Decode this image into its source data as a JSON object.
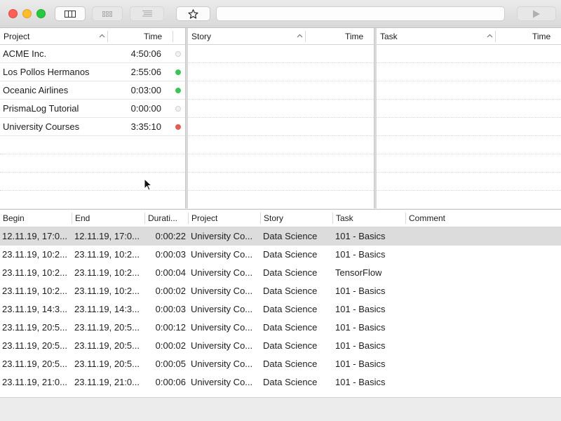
{
  "toolbar": {
    "buttons": [
      {
        "icon": "columns-view-icon",
        "enabled": true
      },
      {
        "icon": "grid-view-icon",
        "enabled": false
      },
      {
        "icon": "list-view-icon",
        "enabled": false
      },
      {
        "icon": "star-icon",
        "enabled": true
      },
      {
        "icon": "play-icon",
        "enabled": false
      }
    ],
    "search": {
      "value": "",
      "placeholder": ""
    }
  },
  "project_pane": {
    "header": {
      "col1": "Project",
      "col2": "Time"
    },
    "rows": [
      {
        "name": "ACME Inc.",
        "time": "4:50:06",
        "status": "gray"
      },
      {
        "name": "Los Pollos Hermanos",
        "time": "2:55:06",
        "status": "green"
      },
      {
        "name": "Oceanic Airlines",
        "time": "0:03:00",
        "status": "green"
      },
      {
        "name": "PrismaLog Tutorial",
        "time": "0:00:00",
        "status": "gray"
      },
      {
        "name": "University Courses",
        "time": "3:35:10",
        "status": "red"
      }
    ]
  },
  "story_pane": {
    "header": {
      "col1": "Story",
      "col2": "Time"
    }
  },
  "task_pane": {
    "header": {
      "col1": "Task",
      "col2": "Time"
    }
  },
  "log_table": {
    "columns": [
      "Begin",
      "End",
      "Durati...",
      "Project",
      "Story",
      "Task",
      "Comment"
    ],
    "rows": [
      {
        "begin": "12.11.19, 17:0...",
        "end": "12.11.19, 17:0...",
        "duration": "0:00:22",
        "project": "University Co...",
        "story": "Data Science",
        "task": "101 - Basics",
        "comment": ""
      },
      {
        "begin": "23.11.19, 10:2...",
        "end": "23.11.19, 10:2...",
        "duration": "0:00:03",
        "project": "University Co...",
        "story": "Data Science",
        "task": "101 - Basics",
        "comment": ""
      },
      {
        "begin": "23.11.19, 10:2...",
        "end": "23.11.19, 10:2...",
        "duration": "0:00:04",
        "project": "University Co...",
        "story": "Data Science",
        "task": "TensorFlow",
        "comment": ""
      },
      {
        "begin": "23.11.19, 10:2...",
        "end": "23.11.19, 10:2...",
        "duration": "0:00:02",
        "project": "University Co...",
        "story": "Data Science",
        "task": "101 - Basics",
        "comment": ""
      },
      {
        "begin": "23.11.19, 14:3...",
        "end": "23.11.19, 14:3...",
        "duration": "0:00:03",
        "project": "University Co...",
        "story": "Data Science",
        "task": "101 - Basics",
        "comment": ""
      },
      {
        "begin": "23.11.19, 20:5...",
        "end": "23.11.19, 20:5...",
        "duration": "0:00:12",
        "project": "University Co...",
        "story": "Data Science",
        "task": "101 - Basics",
        "comment": ""
      },
      {
        "begin": "23.11.19, 20:5...",
        "end": "23.11.19, 20:5...",
        "duration": "0:00:02",
        "project": "University Co...",
        "story": "Data Science",
        "task": "101 - Basics",
        "comment": ""
      },
      {
        "begin": "23.11.19, 20:5...",
        "end": "23.11.19, 20:5...",
        "duration": "0:00:05",
        "project": "University Co...",
        "story": "Data Science",
        "task": "101 - Basics",
        "comment": ""
      },
      {
        "begin": "23.11.19, 21:0...",
        "end": "23.11.19, 21:0...",
        "duration": "0:00:06",
        "project": "University Co...",
        "story": "Data Science",
        "task": "101 - Basics",
        "comment": ""
      }
    ]
  },
  "colors": {
    "status_green": "#3cc45a",
    "status_red": "#e25e50",
    "status_gray": "#f2f2f2",
    "selected_row": "#dcdcdc"
  }
}
